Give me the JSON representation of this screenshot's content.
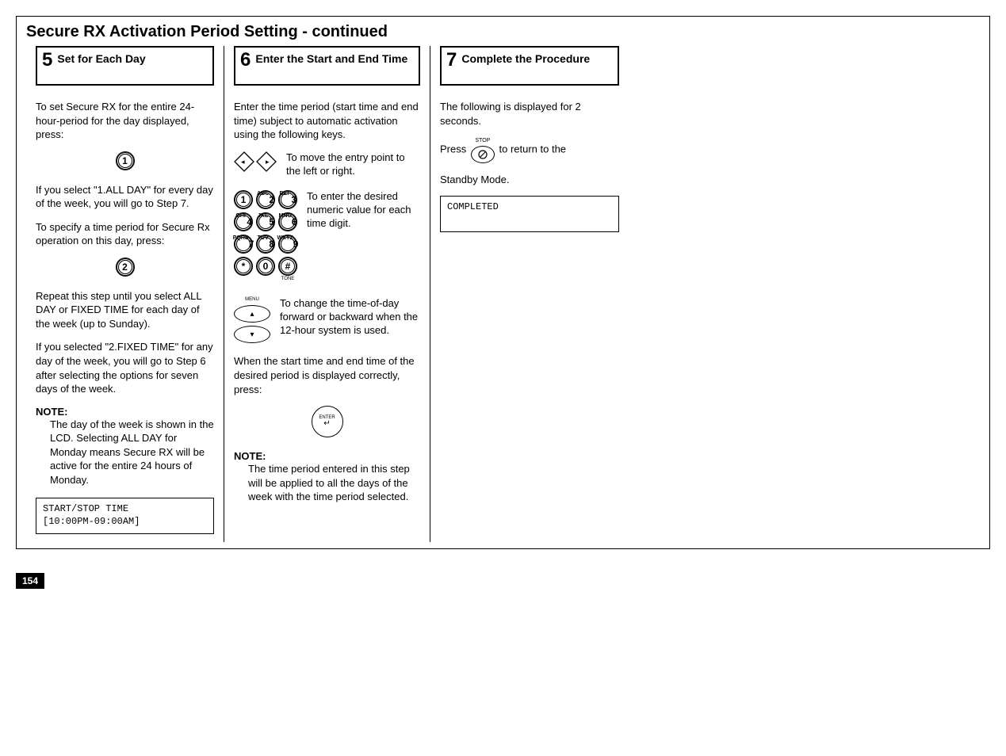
{
  "page_number": "154",
  "section_heading": "Secure RX Activation Period Setting - continued",
  "steps": {
    "s5": {
      "num": "5",
      "title": "Set for Each Day",
      "p1": "To set Secure RX for the entire 24-hour-period for the day displayed, press:",
      "key1": "1",
      "p2": "If you select \"1.ALL DAY\" for every day of the week, you will go to Step 7.",
      "p3": "To specify a time period for Secure Rx operation on this day, press:",
      "key2": "2",
      "p4": "Repeat this step until you select ALL DAY or FIXED TIME for each day of the week (up to Sunday).",
      "p5": "If you selected \"2.FIXED TIME\" for any day of the week, you will go to Step 6 after selecting the options for seven days of the week.",
      "note_label": "NOTE:",
      "note_body": "The day of the week is shown in the LCD. Selecting ALL DAY for Monday means Secure RX will be active for the entire 24 hours of Monday.",
      "lcd": "START/STOP TIME\n[10:00PM-09:00AM]"
    },
    "s6": {
      "num": "6",
      "title": "Enter the Start and End Time",
      "p1": "Enter the time period (start time and end time) subject to automatic activation using the following keys.",
      "arrow_text": "To move the entry point to the left or right.",
      "keypad_text": "To enter the desired numeric value for each time digit.",
      "keys": [
        "1",
        "2",
        "3",
        "4",
        "5",
        "6",
        "7",
        "8",
        "9",
        "*",
        "0",
        "#"
      ],
      "key_labels_top": [
        "",
        "ABC",
        "DEF",
        "GHI",
        "JKL",
        "MNO",
        "PQRS",
        "TUV",
        "WXYZ",
        "",
        "",
        ""
      ],
      "tone_label": "TONE",
      "menu_label": "MENU",
      "updown_text": "To change the time-of-day forward or backward when the 12-hour system is used.",
      "p2": "When the start time and end time of the desired period is displayed correctly, press:",
      "enter_label": "ENTER",
      "note_label": "NOTE:",
      "note_body": "The time period entered in this step will be applied to all the days of the week with the time period selected."
    },
    "s7": {
      "num": "7",
      "title": "Complete the Procedure",
      "p1": "The following is displayed for 2 seconds.",
      "stop_label": "STOP",
      "p2a": "Press",
      "p2b": "to return to the",
      "p3": "Standby Mode.",
      "lcd": "COMPLETED"
    }
  }
}
